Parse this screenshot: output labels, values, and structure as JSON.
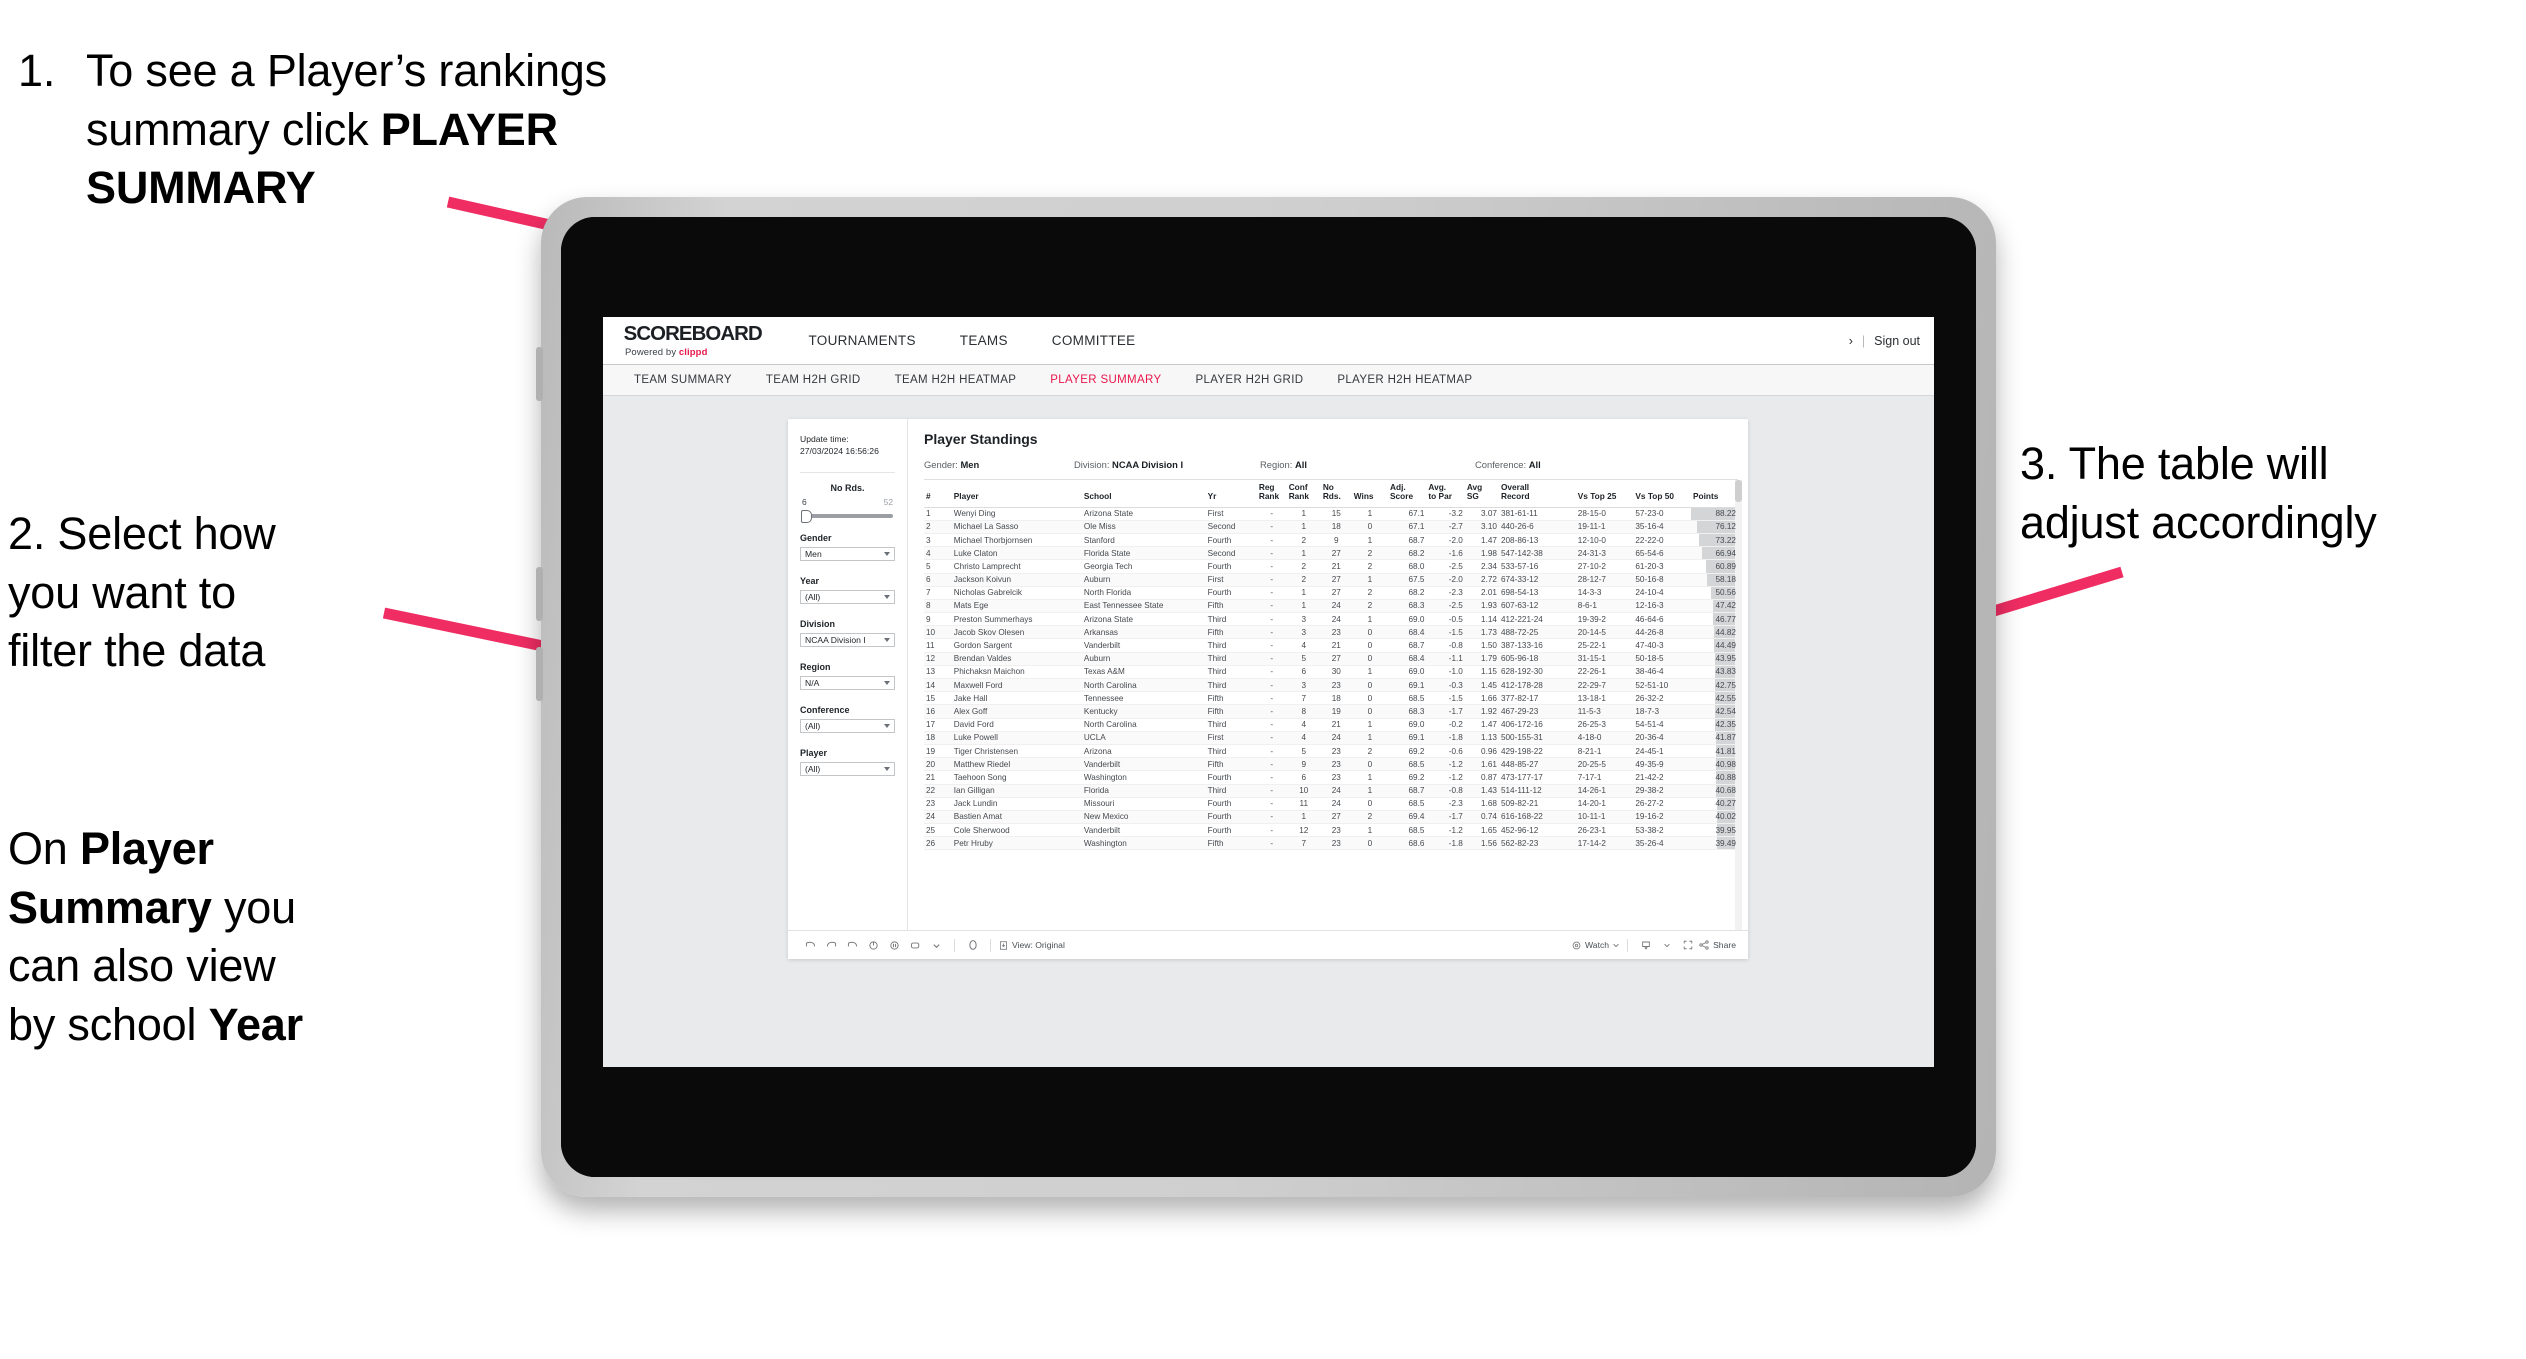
{
  "annotations": {
    "step1": {
      "number": "1.",
      "line1": "To see a Player’s rankings",
      "line2_pre": "summary click ",
      "line2_bold": "PLAYER",
      "line3_bold": "SUMMARY"
    },
    "step2": {
      "line1": "2. Select how",
      "line2": "you want to",
      "line3": "filter the data"
    },
    "step2b": {
      "pre1": "On ",
      "b1": "Player",
      "b2": "Summary",
      "post2": " you",
      "line3": "can also view",
      "line4_pre": "by school ",
      "line4_bold": "Year"
    },
    "step3": {
      "line1": "3. The table will",
      "line2": "adjust accordingly"
    }
  },
  "app": {
    "logo": {
      "main": "SCOREBOARD",
      "sub_pre": "Powered by ",
      "brand": "clippd"
    },
    "topnav": [
      {
        "label": "TOURNAMENTS"
      },
      {
        "label": "TEAMS"
      },
      {
        "label": "COMMITTEE"
      }
    ],
    "topright": {
      "chevron": "›",
      "sep": "|",
      "signout": "Sign out"
    },
    "subnav": [
      {
        "label": "TEAM SUMMARY",
        "active": false
      },
      {
        "label": "TEAM H2H GRID",
        "active": false
      },
      {
        "label": "TEAM H2H HEATMAP",
        "active": false
      },
      {
        "label": "PLAYER SUMMARY",
        "active": true
      },
      {
        "label": "PLAYER H2H GRID",
        "active": false
      },
      {
        "label": "PLAYER H2H HEATMAP",
        "active": false
      }
    ],
    "accent_color": "#e8174b"
  },
  "viz": {
    "update_time_label": "Update time:",
    "update_time_value": "27/03/2024 16:56:26",
    "title": "Player Standings",
    "filters_summary": [
      {
        "label": "Gender:",
        "value": "Men"
      },
      {
        "label": "Division:",
        "value": "NCAA Division I"
      },
      {
        "label": "Region:",
        "value": "All"
      },
      {
        "label": "Conference:",
        "value": "All"
      }
    ],
    "controls": {
      "slider": {
        "label": "No Rds.",
        "min": "6",
        "max": "52"
      },
      "selects": [
        {
          "label": "Gender",
          "value": "Men"
        },
        {
          "label": "Year",
          "value": "(All)"
        },
        {
          "label": "Division",
          "value": "NCAA Division I"
        },
        {
          "label": "Region",
          "value": "N/A"
        },
        {
          "label": "Conference",
          "value": "(All)"
        },
        {
          "label": "Player",
          "value": "(All)"
        }
      ]
    },
    "toolbar": {
      "view_label": "View: Original",
      "watch_label": "Watch",
      "share_label": "Share"
    }
  },
  "chart_data": {
    "type": "table",
    "title": "Player Standings",
    "columns": [
      "#",
      "Player",
      "School",
      "Yr",
      "Reg Rank",
      "Conf Rank",
      "No Rds.",
      "Wins",
      "Adj. Score",
      "Avg. to Par",
      "Avg SG",
      "Overall Record",
      "Vs Top 25",
      "Vs Top 50",
      "Points"
    ],
    "column_headers_two_line": [
      [
        "#",
        ""
      ],
      [
        "Player",
        ""
      ],
      [
        "School",
        ""
      ],
      [
        "Yr",
        ""
      ],
      [
        "Reg",
        "Rank"
      ],
      [
        "Conf",
        "Rank"
      ],
      [
        "No",
        "Rds."
      ],
      [
        "Wins",
        ""
      ],
      [
        "Adj.",
        "Score"
      ],
      [
        "Avg.",
        "to Par"
      ],
      [
        "Avg",
        "SG"
      ],
      [
        "Overall",
        "Record"
      ],
      [
        "Vs Top 25",
        ""
      ],
      [
        "Vs Top 50",
        ""
      ],
      [
        "Points",
        ""
      ]
    ],
    "points_max": 88.22,
    "rows": [
      [
        "1",
        "Wenyi Ding",
        "Arizona State",
        "First",
        "-",
        "1",
        "15",
        "1",
        "67.1",
        "-3.2",
        "3.07",
        "381-61-11",
        "28-15-0",
        "57-23-0",
        "88.22"
      ],
      [
        "2",
        "Michael La Sasso",
        "Ole Miss",
        "Second",
        "-",
        "1",
        "18",
        "0",
        "67.1",
        "-2.7",
        "3.10",
        "440-26-6",
        "19-11-1",
        "35-16-4",
        "76.12"
      ],
      [
        "3",
        "Michael Thorbjornsen",
        "Stanford",
        "Fourth",
        "-",
        "2",
        "9",
        "1",
        "68.7",
        "-2.0",
        "1.47",
        "208-86-13",
        "12-10-0",
        "22-22-0",
        "73.22"
      ],
      [
        "4",
        "Luke Claton",
        "Florida State",
        "Second",
        "-",
        "1",
        "27",
        "2",
        "68.2",
        "-1.6",
        "1.98",
        "547-142-38",
        "24-31-3",
        "65-54-6",
        "66.94"
      ],
      [
        "5",
        "Christo Lamprecht",
        "Georgia Tech",
        "Fourth",
        "-",
        "2",
        "21",
        "2",
        "68.0",
        "-2.5",
        "2.34",
        "533-57-16",
        "27-10-2",
        "61-20-3",
        "60.89"
      ],
      [
        "6",
        "Jackson Koivun",
        "Auburn",
        "First",
        "-",
        "2",
        "27",
        "1",
        "67.5",
        "-2.0",
        "2.72",
        "674-33-12",
        "28-12-7",
        "50-16-8",
        "58.18"
      ],
      [
        "7",
        "Nicholas Gabrelcik",
        "North Florida",
        "Fourth",
        "-",
        "1",
        "27",
        "2",
        "68.2",
        "-2.3",
        "2.01",
        "698-54-13",
        "14-3-3",
        "24-10-4",
        "50.56"
      ],
      [
        "8",
        "Mats Ege",
        "East Tennessee State",
        "Fifth",
        "-",
        "1",
        "24",
        "2",
        "68.3",
        "-2.5",
        "1.93",
        "607-63-12",
        "8-6-1",
        "12-16-3",
        "47.42"
      ],
      [
        "9",
        "Preston Summerhays",
        "Arizona State",
        "Third",
        "-",
        "3",
        "24",
        "1",
        "69.0",
        "-0.5",
        "1.14",
        "412-221-24",
        "19-39-2",
        "46-64-6",
        "46.77"
      ],
      [
        "10",
        "Jacob Skov Olesen",
        "Arkansas",
        "Fifth",
        "-",
        "3",
        "23",
        "0",
        "68.4",
        "-1.5",
        "1.73",
        "488-72-25",
        "20-14-5",
        "44-26-8",
        "44.82"
      ],
      [
        "11",
        "Gordon Sargent",
        "Vanderbilt",
        "Third",
        "-",
        "4",
        "21",
        "0",
        "68.7",
        "-0.8",
        "1.50",
        "387-133-16",
        "25-22-1",
        "47-40-3",
        "44.49"
      ],
      [
        "12",
        "Brendan Valdes",
        "Auburn",
        "Third",
        "-",
        "5",
        "27",
        "0",
        "68.4",
        "-1.1",
        "1.79",
        "605-96-18",
        "31-15-1",
        "50-18-5",
        "43.95"
      ],
      [
        "13",
        "Phichaksn Maichon",
        "Texas A&M",
        "Third",
        "-",
        "6",
        "30",
        "1",
        "69.0",
        "-1.0",
        "1.15",
        "628-192-30",
        "22-26-1",
        "38-46-4",
        "43.83"
      ],
      [
        "14",
        "Maxwell Ford",
        "North Carolina",
        "Third",
        "-",
        "3",
        "23",
        "0",
        "69.1",
        "-0.3",
        "1.45",
        "412-178-28",
        "22-29-7",
        "52-51-10",
        "42.75"
      ],
      [
        "15",
        "Jake Hall",
        "Tennessee",
        "Fifth",
        "-",
        "7",
        "18",
        "0",
        "68.5",
        "-1.5",
        "1.66",
        "377-82-17",
        "13-18-1",
        "26-32-2",
        "42.55"
      ],
      [
        "16",
        "Alex Goff",
        "Kentucky",
        "Fifth",
        "-",
        "8",
        "19",
        "0",
        "68.3",
        "-1.7",
        "1.92",
        "467-29-23",
        "11-5-3",
        "18-7-3",
        "42.54"
      ],
      [
        "17",
        "David Ford",
        "North Carolina",
        "Third",
        "-",
        "4",
        "21",
        "1",
        "69.0",
        "-0.2",
        "1.47",
        "406-172-16",
        "26-25-3",
        "54-51-4",
        "42.35"
      ],
      [
        "18",
        "Luke Powell",
        "UCLA",
        "First",
        "-",
        "4",
        "24",
        "1",
        "69.1",
        "-1.8",
        "1.13",
        "500-155-31",
        "4-18-0",
        "20-36-4",
        "41.87"
      ],
      [
        "19",
        "Tiger Christensen",
        "Arizona",
        "Third",
        "-",
        "5",
        "23",
        "2",
        "69.2",
        "-0.6",
        "0.96",
        "429-198-22",
        "8-21-1",
        "24-45-1",
        "41.81"
      ],
      [
        "20",
        "Matthew Riedel",
        "Vanderbilt",
        "Fifth",
        "-",
        "9",
        "23",
        "0",
        "68.5",
        "-1.2",
        "1.61",
        "448-85-27",
        "20-25-5",
        "49-35-9",
        "40.98"
      ],
      [
        "21",
        "Taehoon Song",
        "Washington",
        "Fourth",
        "-",
        "6",
        "23",
        "1",
        "69.2",
        "-1.2",
        "0.87",
        "473-177-17",
        "7-17-1",
        "21-42-2",
        "40.88"
      ],
      [
        "22",
        "Ian Gilligan",
        "Florida",
        "Third",
        "-",
        "10",
        "24",
        "1",
        "68.7",
        "-0.8",
        "1.43",
        "514-111-12",
        "14-26-1",
        "29-38-2",
        "40.68"
      ],
      [
        "23",
        "Jack Lundin",
        "Missouri",
        "Fourth",
        "-",
        "11",
        "24",
        "0",
        "68.5",
        "-2.3",
        "1.68",
        "509-82-21",
        "14-20-1",
        "26-27-2",
        "40.27"
      ],
      [
        "24",
        "Bastien Amat",
        "New Mexico",
        "Fourth",
        "-",
        "1",
        "27",
        "2",
        "69.4",
        "-1.7",
        "0.74",
        "616-168-22",
        "10-11-1",
        "19-16-2",
        "40.02"
      ],
      [
        "25",
        "Cole Sherwood",
        "Vanderbilt",
        "Fourth",
        "-",
        "12",
        "23",
        "1",
        "68.5",
        "-1.2",
        "1.65",
        "452-96-12",
        "26-23-1",
        "53-38-2",
        "39.95"
      ],
      [
        "26",
        "Petr Hruby",
        "Washington",
        "Fifth",
        "-",
        "7",
        "23",
        "0",
        "68.6",
        "-1.8",
        "1.56",
        "562-82-23",
        "17-14-2",
        "35-26-4",
        "39.49"
      ]
    ]
  }
}
